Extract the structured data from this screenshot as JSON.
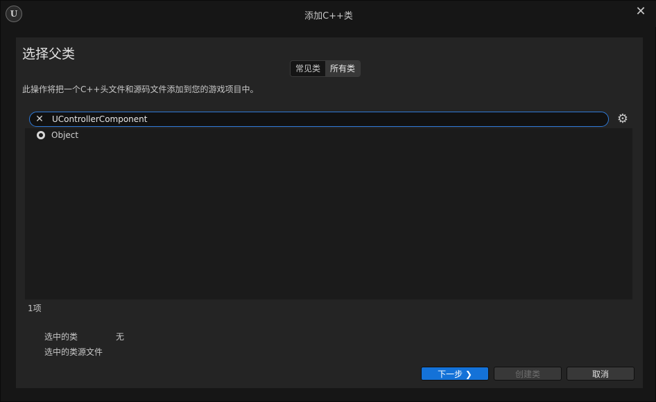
{
  "window": {
    "title": "添加C++类",
    "logo_text": "U",
    "close_glyph": "✕"
  },
  "page": {
    "heading": "选择父类",
    "tabs": [
      {
        "label": "常见类",
        "active": false
      },
      {
        "label": "所有类",
        "active": true
      }
    ],
    "description": "此操作将把一个C++头文件和源码文件添加到您的游戏项目中。"
  },
  "search": {
    "value": "UControllerComponent",
    "clear_glyph": "✕",
    "settings_glyph": "⚙"
  },
  "class_list": {
    "items": [
      {
        "label": "Object",
        "icon": "object-icon"
      }
    ],
    "count_text": "1项"
  },
  "selection_info": {
    "selected_class_label": "选中的类",
    "selected_class_value": "无",
    "selected_source_label": "选中的类源文件"
  },
  "buttons": {
    "next": "下一步 ❯",
    "create": "创建类",
    "cancel": "取消"
  },
  "colors": {
    "accent": "#1472d8",
    "focus_border": "#2f7ad8",
    "panel": "#242424"
  }
}
